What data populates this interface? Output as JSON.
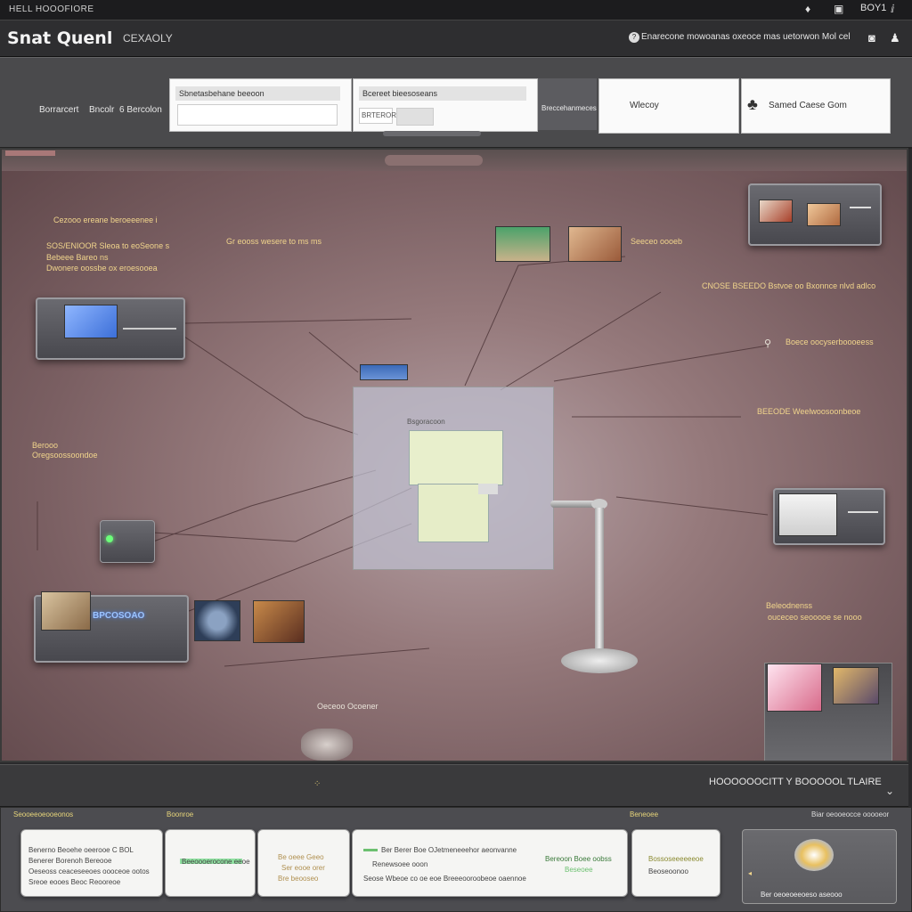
{
  "topbar": {
    "title": "HELL HOOOFIORE",
    "icons": [
      "bell-icon",
      "window-icon",
      "battery-icon",
      "info-icon"
    ],
    "status_text": "BOY1"
  },
  "header": {
    "brand": "Snat Quenl",
    "subtitle": "CEXAOLY",
    "right_text": "Enarecone mowoanas oxeoce mas uetorwon Mol cel"
  },
  "toolbar": {
    "left_labels": [
      "Borrarcert",
      "Bncolr",
      "6 Bercolon"
    ],
    "panel1_caption": "Sbnetasbehane  beeoon",
    "panel2_caption": "Bcereet bieesoseans",
    "panel2_field1": "BRTEROR",
    "panel2_field2": "",
    "divider_label": "Breccehanmeces",
    "search_label": "Wlecoy",
    "account_label": "Samed Caese Gom"
  },
  "canvas": {
    "labels": [
      {
        "id": "l1",
        "text": "Cezooo  ereane beroeeenee i"
      },
      {
        "id": "l2",
        "text": "SOS/ENIOOR Sleoa to eoSeone s"
      },
      {
        "id": "l3",
        "text": "Bebeee Bareo  ns"
      },
      {
        "id": "l4",
        "text": "Dwonere oossbe ox eroesooea"
      },
      {
        "id": "l5",
        "text": "Gr eooss wesere to ms ms"
      },
      {
        "id": "l6",
        "text": "Seeceo oooeb"
      },
      {
        "id": "l7",
        "text": "CNOSE  BSEEDO  Bstvoe oo  Bxonnce  nlvd  adlco"
      },
      {
        "id": "l8",
        "text": "Boece oocyserboooeess"
      },
      {
        "id": "l9",
        "text": "BEEODE   Weelwoosoonbeoe"
      },
      {
        "id": "l10",
        "text": "Berooo"
      },
      {
        "id": "l11",
        "text": "Oregsoossoondoe"
      },
      {
        "id": "l12",
        "text": "Beleodnenss"
      },
      {
        "id": "l13",
        "text": "ouceceo seooooe se nooo"
      },
      {
        "id": "l14",
        "text": "Oeceoo Ocoener"
      },
      {
        "id": "l15",
        "text": "BPCOSOAO"
      }
    ],
    "center_caption": "Bsgoracoon"
  },
  "strip": {
    "right_text": "HOOOOOOCITT  Y BOOOOOL TLAIRE"
  },
  "bottom": {
    "headers": [
      "Seooeeoeooeonos",
      "Boonroe",
      "Beneoee",
      "Biar oeooeocce ooooeor"
    ],
    "cards": [
      {
        "line1": "Benerno Beoehe oeerooe C BOL",
        "line2": "Benerer Borenoh  Bereooe",
        "line3": "Oeseoss ceaceseeoes oooceoe ootos",
        "line4": "Sreoe eooes Beoc Reooreoe"
      },
      {
        "line1": "Beeoooerocone eeoe"
      },
      {
        "line1": "Be oeee Geeo",
        "line2": "Ser eooe orer",
        "line3": "Bre beooseo"
      },
      {
        "line1": "Ber Berer Boe OJetmeneeehor aeonvanne",
        "line2": "Renewsoee ooon",
        "line3": "Seose  Wbeoe co oe eoe   Breeeooroobeoe oaennoe",
        "right1": "Bereoon Boee oobss",
        "right2": "Beseoee"
      },
      {
        "line1": "Bossoseeeeeeoe",
        "line2": "Beoseoonoo"
      },
      {
        "line1": "Ber oeoeoeeoeso aseooo"
      }
    ]
  },
  "colors": {
    "accent": "#f1d58c",
    "canvas_base": "#967a7c",
    "panel": "#4a4a4c"
  }
}
